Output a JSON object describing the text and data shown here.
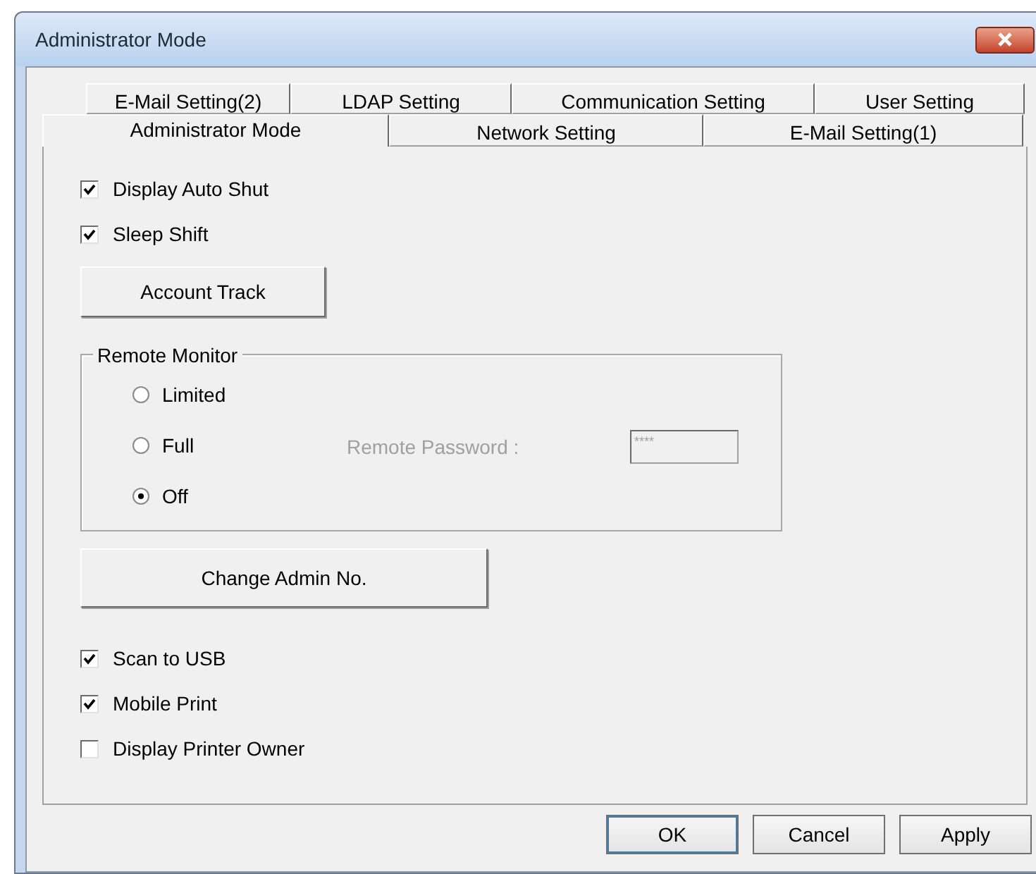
{
  "window": {
    "title": "Administrator Mode"
  },
  "tabs": [
    [
      {
        "label": "E-Mail Setting(2)",
        "selected": false
      },
      {
        "label": "LDAP Setting",
        "selected": false
      },
      {
        "label": "Communication Setting",
        "selected": false
      },
      {
        "label": "User Setting",
        "selected": false
      }
    ],
    [
      {
        "label": "Administrator Mode",
        "selected": true
      },
      {
        "label": "Network Setting",
        "selected": false
      },
      {
        "label": "E-Mail Setting(1)",
        "selected": false
      }
    ]
  ],
  "top_options": [
    {
      "label": "Display Auto Shut",
      "checked": true
    },
    {
      "label": "Sleep Shift",
      "checked": true
    }
  ],
  "account_track_button": "Account Track",
  "remote_monitor": {
    "title": "Remote Monitor",
    "options": [
      {
        "label": "Limited",
        "selected": false
      },
      {
        "label": "Full",
        "selected": false
      },
      {
        "label": "Off",
        "selected": true
      }
    ],
    "password_label": "Remote Password :",
    "password_value": "****",
    "disabled": true
  },
  "change_admin_button": "Change Admin No.",
  "bottom_options": [
    {
      "label": "Scan to USB",
      "checked": true
    },
    {
      "label": "Mobile Print",
      "checked": true
    },
    {
      "label": "Display Printer Owner",
      "checked": false
    }
  ],
  "buttons": [
    "OK",
    "Cancel",
    "Apply"
  ]
}
